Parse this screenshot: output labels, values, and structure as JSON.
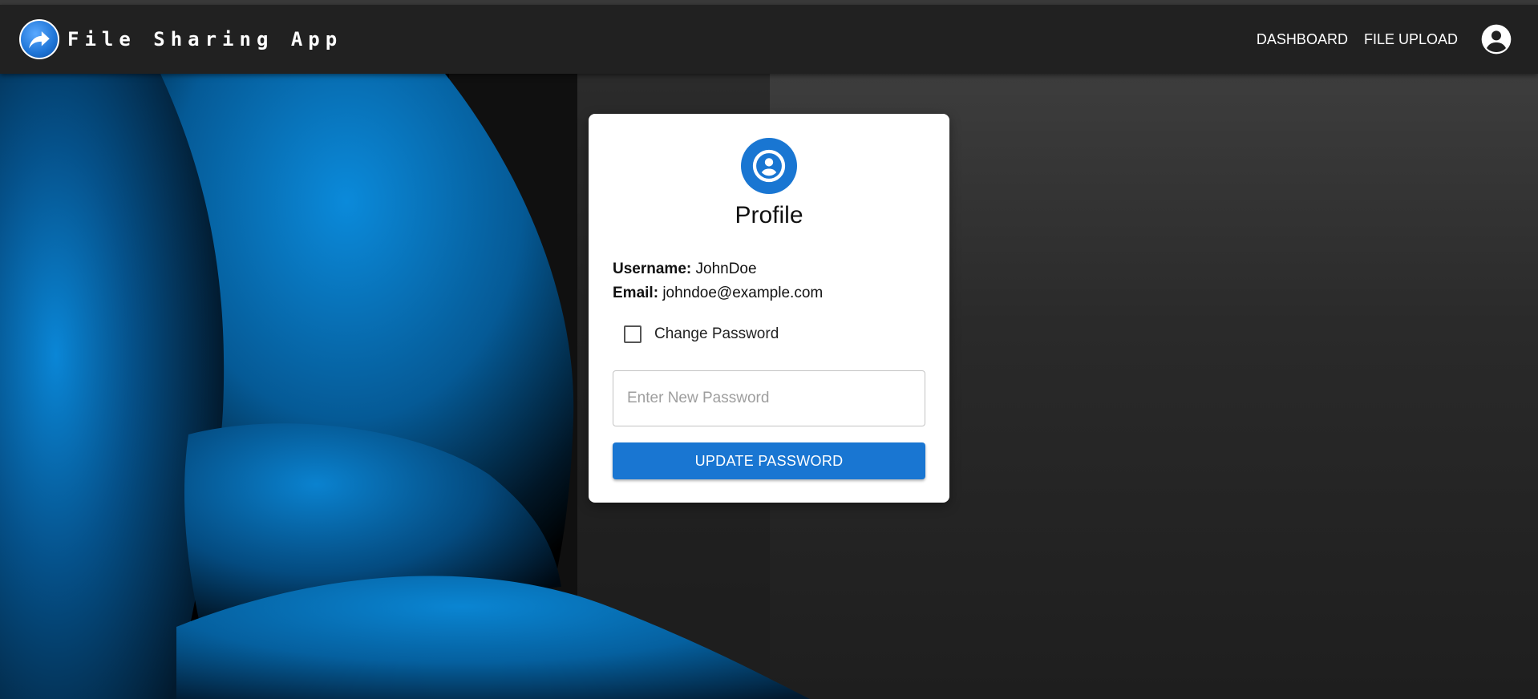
{
  "app": {
    "title": "File Sharing App",
    "logo_icon": "share-arrow-icon"
  },
  "nav": {
    "links": [
      {
        "label": "DASHBOARD"
      },
      {
        "label": "FILE UPLOAD"
      }
    ],
    "account_icon": "account-circle-icon"
  },
  "profile": {
    "icon": "account-circle-icon",
    "title": "Profile",
    "username_label": "Username:",
    "username_value": "JohnDoe",
    "email_label": "Email:",
    "email_value": "johndoe@example.com",
    "change_password_label": "Change Password",
    "change_password_checked": false,
    "new_password_placeholder": "Enter New Password",
    "new_password_value": "",
    "update_button_label": "UPDATE PASSWORD"
  },
  "colors": {
    "primary": "#1976d2",
    "navbar": "#212121",
    "card": "#ffffff",
    "wallpaper_blue": "#0a7fd0"
  }
}
